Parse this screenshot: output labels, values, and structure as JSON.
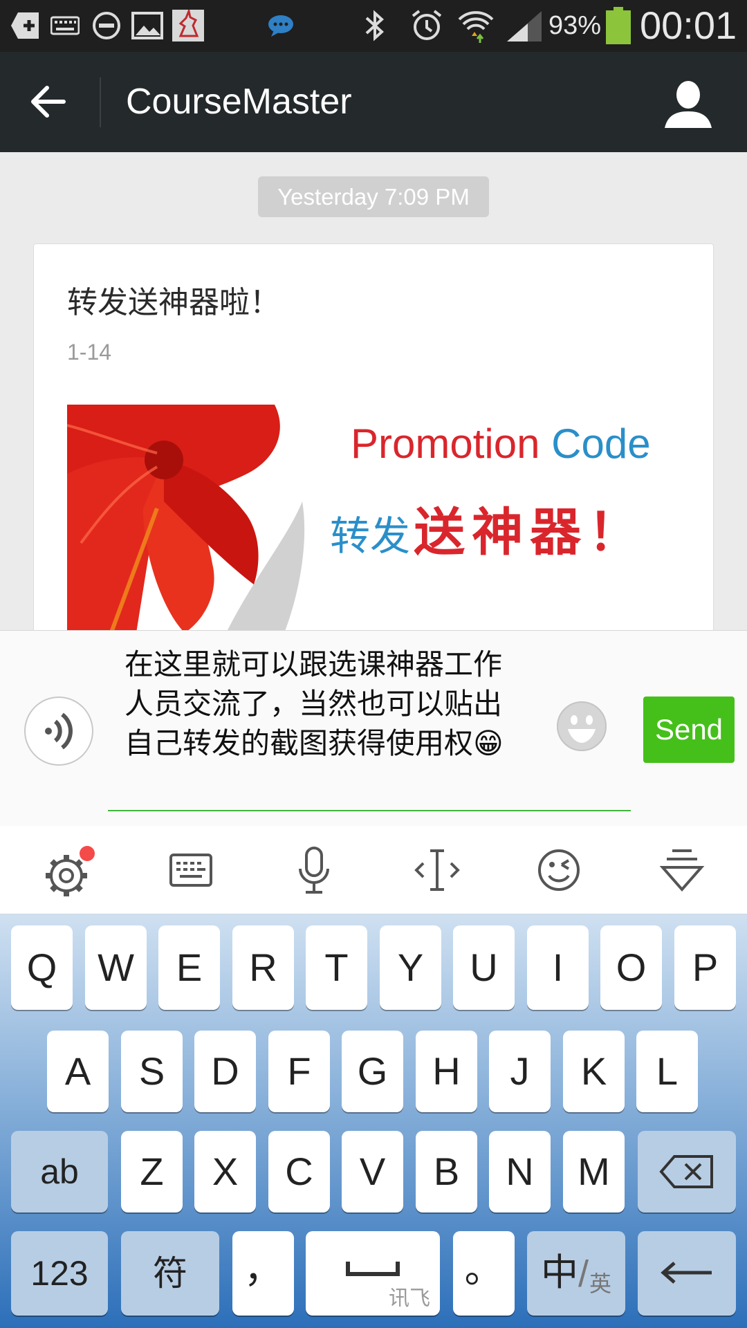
{
  "status_bar": {
    "battery_percent": "93%",
    "time": "00:01"
  },
  "app_bar": {
    "title": "CourseMaster"
  },
  "chat": {
    "timestamp": "Yesterday 7:09 PM",
    "card": {
      "title": "转发送神器啦！",
      "date": "1-14",
      "banner_title_part1": "Promotion",
      "banner_title_part2": "Code",
      "banner_sub_part1": "转发",
      "banner_sub_part2": "送神器！"
    }
  },
  "composer": {
    "message": "在这里就可以跟选课神器工作人员交流了，当然也可以贴出自己转发的截图获得使用权😁",
    "send_label": "Send"
  },
  "keyboard": {
    "row1": [
      "Q",
      "W",
      "E",
      "R",
      "T",
      "Y",
      "U",
      "I",
      "O",
      "P"
    ],
    "row2": [
      "A",
      "S",
      "D",
      "F",
      "G",
      "H",
      "J",
      "K",
      "L"
    ],
    "row3": [
      "Z",
      "X",
      "C",
      "V",
      "B",
      "N",
      "M"
    ],
    "shift_label": "ab",
    "numbers_label": "123",
    "symbols_label": "符",
    "comma_label": "，",
    "space_brand": "讯飞",
    "period_label": "。",
    "lang_main": "中",
    "lang_alt": "英"
  },
  "colors": {
    "send_green": "#45c01a",
    "app_bar": "#24292b",
    "promo_red": "#d9262c",
    "promo_blue": "#2a8fc9"
  },
  "icons": [
    "add-box-icon",
    "keyboard-icon",
    "do-not-disturb-icon",
    "image-icon",
    "unicorn-app-icon",
    "chat-bubble-icon",
    "bluetooth-icon",
    "alarm-icon",
    "wifi-icon",
    "signal-icon",
    "battery-icon",
    "back-arrow-icon",
    "profile-icon",
    "voice-icon",
    "emoji-icon",
    "settings-icon",
    "keyboard-toggle-icon",
    "microphone-icon",
    "cursor-icon",
    "wink-emoji-icon",
    "collapse-icon",
    "backspace-icon",
    "enter-icon"
  ]
}
